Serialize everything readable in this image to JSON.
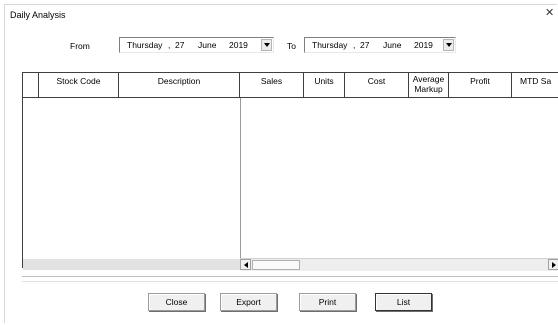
{
  "window": {
    "title": "Daily Analysis"
  },
  "icons": {
    "close": "close-icon",
    "dropdown": "chevron-down-icon",
    "scroll_left": "arrow-left-icon",
    "scroll_right": "arrow-right-icon"
  },
  "filters": {
    "from_label": "From",
    "to_label": "To",
    "from_date": {
      "weekday": "Thursday",
      "day": "27",
      "month": "June",
      "year": "2019"
    },
    "to_date": {
      "weekday": "Thursday",
      "day": "27",
      "month": "June",
      "year": "2019"
    }
  },
  "grid": {
    "columns": [
      "",
      "Stock Code",
      "Description",
      "Sales",
      "Units",
      "Cost",
      "Average\nMarkup",
      "Profit",
      "MTD Sa"
    ],
    "rows": []
  },
  "buttons": {
    "close": "Close",
    "export": "Export",
    "print": "Print",
    "list": "List"
  }
}
